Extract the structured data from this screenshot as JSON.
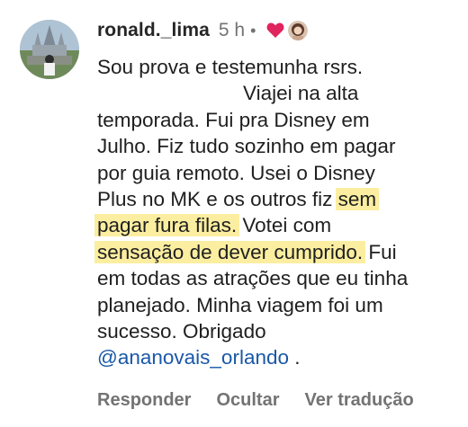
{
  "comment": {
    "username": "ronald._lima",
    "time": "5 h",
    "separator": "•",
    "body_lines": {
      "l1": "Sou prova e testemunha rsrs.",
      "l2": "Viajei na alta",
      "l3": "temporada. Fui pra Disney em",
      "l4": "Julho. Fiz tudo sozinho em pagar",
      "l5": "por guia remoto. Usei o Disney",
      "l6a": "Plus no MK e os outros fiz ",
      "l6b": "sem",
      "l7a": "pagar fura filas.",
      "l7b": " Votei com",
      "l8a": "sensação de dever cumprido.",
      "l8b": " Fui",
      "l9": "em todas as atrações que eu tinha",
      "l10": "planejado. Minha viagem foi um",
      "l11": "sucesso. Obrigado",
      "l12_mention": "@ananovais_orlando",
      "l12_tail": " ."
    },
    "highlight_color": "#fbeea0",
    "heart_color": "#e0245e",
    "mention_color": "#1a58a8"
  },
  "actions": {
    "reply": "Responder",
    "hide": "Ocultar",
    "translate": "Ver tradução"
  }
}
